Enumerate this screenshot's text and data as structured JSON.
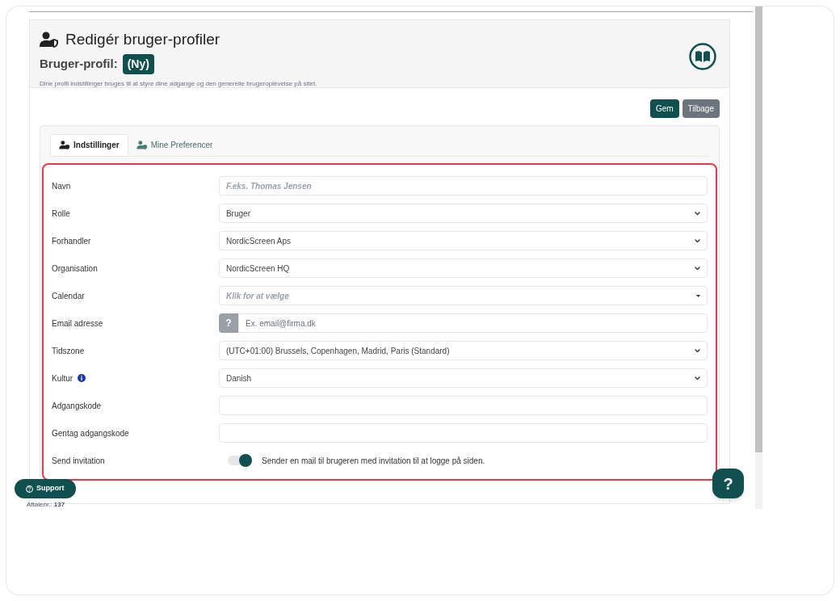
{
  "header": {
    "title": "Redigér bruger-profiler",
    "subtitle": "Bruger-profil:",
    "badge": "(Ny)",
    "description": "Dine profil indstillinger bruges til at styre dine adgange og den generelle brugeroplevelse på sitet."
  },
  "actions": [
    {
      "label": "Gem",
      "kind": "primary"
    },
    {
      "label": "Tilbage",
      "kind": "secondary"
    }
  ],
  "tabs": [
    {
      "label": "Indstillinger",
      "selected": true
    },
    {
      "label": "Mine Preferencer",
      "selected": false
    }
  ],
  "fields": [
    {
      "label": "Navn",
      "kind": "text",
      "placeholder": "F.eks. Thomas Jensen"
    },
    {
      "label": "Rolle",
      "kind": "select",
      "value": "Bruger"
    },
    {
      "label": "Forhandler",
      "kind": "select",
      "value": "NordicScreen Aps"
    },
    {
      "label": "Organisation",
      "kind": "select",
      "value": "NordicScreen HQ"
    },
    {
      "label": "Calendar",
      "kind": "combo",
      "placeholder": "Klik for at vælge"
    },
    {
      "label": "Email adresse",
      "kind": "email",
      "addon": "?",
      "placeholder": "Ex. email@firma.dk"
    },
    {
      "label": "Tidszone",
      "kind": "select",
      "value": "(UTC+01:00) Brussels, Copenhagen, Madrid, Paris (Standard)"
    },
    {
      "label": "Kultur",
      "kind": "select",
      "info": true,
      "value": "Danish"
    },
    {
      "label": "Adgangskode",
      "kind": "password"
    },
    {
      "label": "Gentag adgangskode",
      "kind": "password"
    },
    {
      "label": "Send invitation",
      "kind": "toggle",
      "on": true,
      "text": "Sender en mail til brugeren med invitation til at logge på siden."
    }
  ],
  "support_button": "Support",
  "help_button": "?",
  "footer": "Aftalenr.: **137**"
}
